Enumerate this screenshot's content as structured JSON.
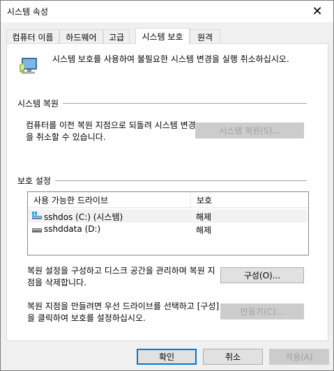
{
  "window": {
    "title": "시스템 속성",
    "close_label": "✕"
  },
  "tabs": [
    {
      "label": "컴퓨터 이름"
    },
    {
      "label": "하드웨어"
    },
    {
      "label": "고급"
    },
    {
      "label": "시스템 보호"
    },
    {
      "label": "원격"
    }
  ],
  "intro": {
    "text": "시스템 보호를 사용하여 불필요한 시스템 변경을 실행 취소하십시오."
  },
  "restore": {
    "group_title": "시스템 복원",
    "description": "컴퓨터를 이전 복원 지점으로 되돌려 시스템 변경을 취소할 수 있습니다.",
    "button_label": "시스템 복원(S)..."
  },
  "protection": {
    "group_title": "보호 설정",
    "columns": [
      "사용 가능한 드라이브",
      "보호"
    ],
    "drives": [
      {
        "name": "sshdos (C:) (시스템)",
        "protection": "해제",
        "icon": "system-drive-icon"
      },
      {
        "name": "sshddata (D:)",
        "protection": "해제",
        "icon": "drive-icon"
      }
    ],
    "configure_description": "복원 설정을 구성하고 디스크 공간을 관리하며 복원 지점을 삭제합니다.",
    "configure_label": "구성(O)...",
    "create_description": "복원 지점을 만들려면 우선 드라이브를 선택하고 [구성]을 클릭하여 보호를 설정하십시오.",
    "create_label": "만들기(C)..."
  },
  "footer": {
    "ok_label": "확인",
    "cancel_label": "취소",
    "apply_label": "적용(A)"
  },
  "colors": {
    "accent": "#0078d7",
    "disabled_text": "#a0a0a0"
  }
}
